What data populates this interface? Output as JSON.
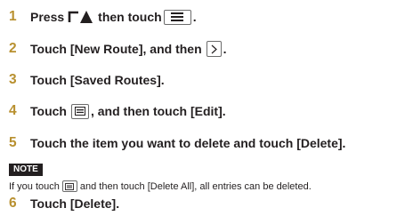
{
  "steps": [
    {
      "num": "1",
      "before": "Press",
      "middle": "then touch",
      "after": "."
    },
    {
      "num": "2",
      "before": "Touch [New Route], and then",
      "after": "."
    },
    {
      "num": "3",
      "text": "Touch [Saved Routes]."
    },
    {
      "num": "4",
      "before": "Touch",
      "after": ", and then touch [Edit]."
    },
    {
      "num": "5",
      "text": "Touch the item you want to delete and touch [Delete]."
    },
    {
      "num": "6",
      "text": "Touch [Delete]."
    }
  ],
  "note": {
    "label": "NOTE",
    "before": "If you touch",
    "after": "and then touch [Delete All], all entries can be deleted."
  },
  "colors": {
    "step_number": "#b8902f",
    "text": "#231f20"
  },
  "icons": [
    "navi-icon",
    "menu-icon",
    "chevron-right-icon",
    "list-icon"
  ]
}
